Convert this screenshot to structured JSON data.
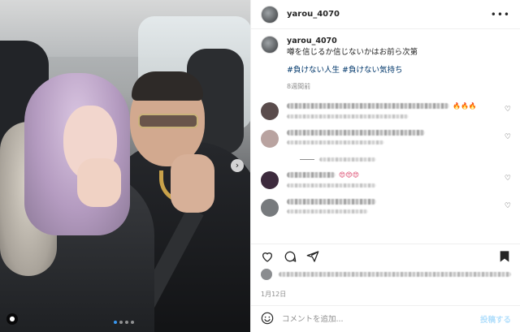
{
  "post": {
    "username": "yarou_4070",
    "caption_user": "yarou_4070",
    "caption_text": "噂を信じるか信じないかはお前ら次第",
    "hashtags": "#負けない人生 #負けない気持ち",
    "posted_ago": "8週間前",
    "date": "1月12日"
  },
  "header": {
    "more_icon": "more-icon"
  },
  "photo": {
    "next_icon": "chevron-right-icon",
    "carousel_dots": 4,
    "active_dot": 1,
    "tag_icon": "user-tag-icon"
  },
  "comments": [
    {
      "avatar_color": "#5a4c4c",
      "emoji": "🔥🔥🔥",
      "emoji_color": "#e0772b"
    },
    {
      "avatar_color": "#b9a3a0",
      "emoji": "",
      "emoji_color": "#8e8e8e"
    },
    {
      "avatar_color": "#3d2b3d",
      "emoji": "😍😍😍",
      "emoji_color": "#d8365f"
    },
    {
      "avatar_color": "#777a7d",
      "emoji": "",
      "emoji_color": "#8e8e8e"
    }
  ],
  "actions": {
    "like_icon": "heart-icon",
    "comment_icon": "comment-icon",
    "share_icon": "share-icon",
    "save_icon": "bookmark-icon"
  },
  "add_comment": {
    "placeholder": "コメントを追加...",
    "post_label": "投稿する",
    "emoji_icon": "smiley-icon"
  }
}
